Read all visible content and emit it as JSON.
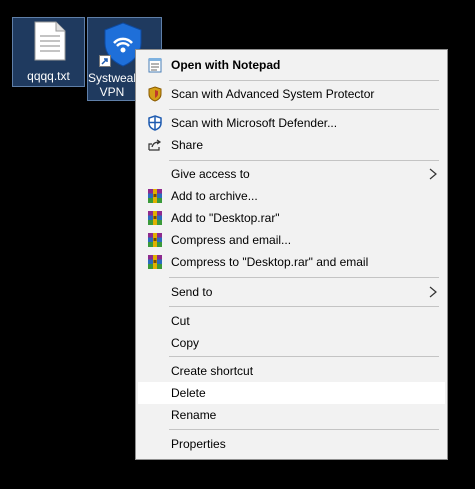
{
  "desktop": {
    "icons": [
      {
        "label": "qqqq.txt"
      },
      {
        "label": "Systweak VPN"
      }
    ]
  },
  "menu": {
    "items": [
      {
        "label": "Open with Notepad",
        "icon": "notepad-icon"
      },
      {
        "label": "Scan with Advanced System Protector",
        "icon": "asp-shield-icon"
      },
      {
        "label": "Scan with Microsoft Defender...",
        "icon": "defender-icon"
      },
      {
        "label": "Share",
        "icon": "share-icon"
      },
      {
        "label": "Give access to",
        "icon": "",
        "submenu": true
      },
      {
        "label": "Add to archive...",
        "icon": "winrar-icon"
      },
      {
        "label": "Add to \"Desktop.rar\"",
        "icon": "winrar-icon"
      },
      {
        "label": "Compress and email...",
        "icon": "winrar-icon"
      },
      {
        "label": "Compress to \"Desktop.rar\" and email",
        "icon": "winrar-icon"
      },
      {
        "label": "Send to",
        "icon": "",
        "submenu": true
      },
      {
        "label": "Cut",
        "icon": ""
      },
      {
        "label": "Copy",
        "icon": ""
      },
      {
        "label": "Create shortcut",
        "icon": ""
      },
      {
        "label": "Delete",
        "icon": ""
      },
      {
        "label": "Rename",
        "icon": ""
      },
      {
        "label": "Properties",
        "icon": ""
      }
    ]
  },
  "colors": {
    "desktop_bg": "#000000",
    "selection_fill": "#1f3a5f",
    "menu_bg": "#f2f2f2",
    "hover_bg": "#ffffff"
  }
}
